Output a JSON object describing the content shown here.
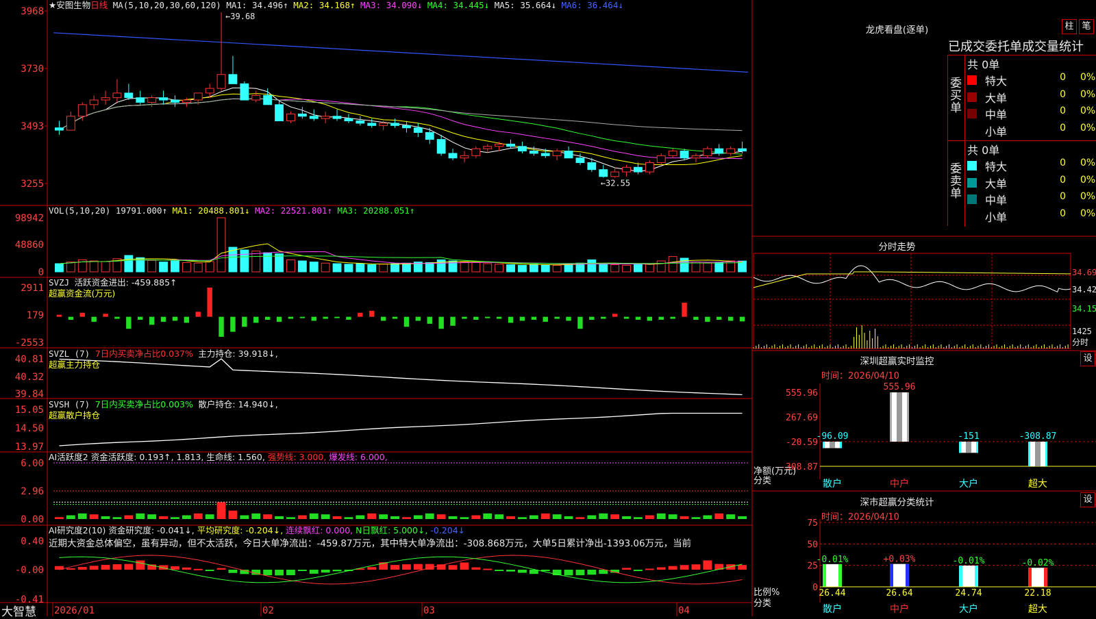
{
  "app": {
    "name": "大智慧"
  },
  "chart_data": [
    {
      "type": "candlestick",
      "name": "安图生物 日线",
      "interval": "日线",
      "x_labels": [
        "2026/01",
        "02",
        "03",
        "04"
      ],
      "y_ticks": [
        "3968",
        "3730",
        "3493",
        "3255"
      ],
      "high_mark": "39.68",
      "low_mark": "32.55",
      "ohlc": [
        [
          34.7,
          35.0,
          34.4,
          34.6
        ],
        [
          34.6,
          35.4,
          34.6,
          35.2
        ],
        [
          35.2,
          35.8,
          35.0,
          35.7
        ],
        [
          35.7,
          36.1,
          35.5,
          35.9
        ],
        [
          35.9,
          36.3,
          35.7,
          36.0
        ],
        [
          36.0,
          36.8,
          35.8,
          36.2
        ],
        [
          36.2,
          36.6,
          35.9,
          36.0
        ],
        [
          36.0,
          36.3,
          35.7,
          35.8
        ],
        [
          35.8,
          36.1,
          35.6,
          36.0
        ],
        [
          36.0,
          36.3,
          35.7,
          35.9
        ],
        [
          35.9,
          36.1,
          35.6,
          35.8
        ],
        [
          35.8,
          36.0,
          35.6,
          35.9
        ],
        [
          35.9,
          36.2,
          35.7,
          36.2
        ],
        [
          36.2,
          36.6,
          36.0,
          36.4
        ],
        [
          36.4,
          39.68,
          36.3,
          37.0
        ],
        [
          37.0,
          37.8,
          36.8,
          36.6
        ],
        [
          36.6,
          36.7,
          35.9,
          35.9
        ],
        [
          35.9,
          36.3,
          35.8,
          36.1
        ],
        [
          36.1,
          36.4,
          35.8,
          35.7
        ],
        [
          35.7,
          35.9,
          35.0,
          35.0
        ],
        [
          35.0,
          35.4,
          34.9,
          35.3
        ],
        [
          35.3,
          35.6,
          35.1,
          35.2
        ],
        [
          35.2,
          35.5,
          35.0,
          35.1
        ],
        [
          35.1,
          35.4,
          34.9,
          35.2
        ],
        [
          35.2,
          35.5,
          35.0,
          35.1
        ],
        [
          35.1,
          35.3,
          34.9,
          35.0
        ],
        [
          35.0,
          35.2,
          34.8,
          34.9
        ],
        [
          34.9,
          35.1,
          34.7,
          34.8
        ],
        [
          34.8,
          35.0,
          34.6,
          34.9
        ],
        [
          34.9,
          35.1,
          34.7,
          34.8
        ],
        [
          34.8,
          35.0,
          34.5,
          34.7
        ],
        [
          34.7,
          34.9,
          34.3,
          34.5
        ],
        [
          34.5,
          34.7,
          34.0,
          34.2
        ],
        [
          34.2,
          34.4,
          33.5,
          33.6
        ],
        [
          33.6,
          33.8,
          33.3,
          33.4
        ],
        [
          33.4,
          33.7,
          33.2,
          33.5
        ],
        [
          33.5,
          33.9,
          33.4,
          33.8
        ],
        [
          33.8,
          34.0,
          33.6,
          33.9
        ],
        [
          33.9,
          34.1,
          33.7,
          34.0
        ],
        [
          34.0,
          34.2,
          33.8,
          33.9
        ],
        [
          33.9,
          34.1,
          33.6,
          33.7
        ],
        [
          33.7,
          33.9,
          33.5,
          33.6
        ],
        [
          33.6,
          33.8,
          33.4,
          33.5
        ],
        [
          33.5,
          33.8,
          33.3,
          33.7
        ],
        [
          33.7,
          33.9,
          33.4,
          33.4
        ],
        [
          33.4,
          33.6,
          33.1,
          33.2
        ],
        [
          33.2,
          33.4,
          32.8,
          32.9
        ],
        [
          32.9,
          33.1,
          32.55,
          32.6
        ],
        [
          32.6,
          33.0,
          32.55,
          32.8
        ],
        [
          32.8,
          33.1,
          32.6,
          33.0
        ],
        [
          33.0,
          33.2,
          32.7,
          32.8
        ],
        [
          32.8,
          33.3,
          32.7,
          33.2
        ],
        [
          33.2,
          33.6,
          33.1,
          33.5
        ],
        [
          33.5,
          33.8,
          33.4,
          33.7
        ],
        [
          33.7,
          33.8,
          33.3,
          33.4
        ],
        [
          33.4,
          33.6,
          33.2,
          33.5
        ],
        [
          33.5,
          33.9,
          33.4,
          33.8
        ],
        [
          33.8,
          34.0,
          33.5,
          33.6
        ],
        [
          33.6,
          33.9,
          33.5,
          33.8
        ],
        [
          33.8,
          34.1,
          33.6,
          33.7
        ]
      ],
      "ma_values": {
        "MA1": "34.496",
        "MA2": "34.168",
        "MA3": "34.090",
        "MA4": "34.445",
        "MA5": "35.664",
        "MA6": "36.464"
      }
    },
    {
      "type": "bar",
      "name": "VOL(5,10,20)",
      "y_ticks": [
        "98942",
        "48860",
        "0"
      ],
      "values": [
        15000,
        18000,
        22000,
        20000,
        19000,
        24000,
        30000,
        26000,
        21000,
        18000,
        20000,
        17000,
        16000,
        19000,
        98942,
        45000,
        40000,
        38000,
        35000,
        33000,
        22000,
        20000,
        18000,
        16000,
        15000,
        14000,
        15000,
        13000,
        14000,
        15000,
        16000,
        18000,
        17000,
        22000,
        20000,
        18000,
        17000,
        15000,
        14000,
        13000,
        12000,
        14000,
        13000,
        12000,
        15000,
        16000,
        22000,
        14000,
        13000,
        12000,
        14000,
        15000,
        20000,
        28000,
        25000,
        18000,
        16000,
        17000,
        20000,
        19791
      ],
      "ma": {
        "MA1": "20488.801",
        "MA2": "22521.801",
        "MA3": "20288.051"
      }
    },
    {
      "type": "bar",
      "name": "SVZJ 活跃资金进出",
      "y_ticks": [
        "2911",
        "179",
        "-2553"
      ],
      "values": [
        200,
        -300,
        400,
        -500,
        300,
        -200,
        -1200,
        -300,
        -800,
        -500,
        -400,
        -600,
        500,
        2911,
        -2000,
        -1500,
        -1000,
        -600,
        -300,
        -500,
        -200,
        -100,
        -400,
        -200,
        -100,
        -300,
        400,
        600,
        -400,
        -200,
        -1000,
        -400,
        -700,
        -1200,
        -900,
        -200,
        -300,
        -100,
        -200,
        -600,
        -400,
        -300,
        -500,
        -200,
        -400,
        -1200,
        -300,
        -200,
        300,
        -200,
        -300,
        -400,
        -300,
        -200,
        1400,
        -300,
        -500,
        -300,
        -400,
        -460
      ],
      "value_label": "-459.885",
      "subtitle": "超赢资金流(万元)"
    },
    {
      "type": "line",
      "name": "SVZL 超赢主力持仓",
      "y_ticks": [
        "40.81",
        "40.32",
        "39.84"
      ],
      "value": "39.918",
      "ratio": "0.037%"
    },
    {
      "type": "line",
      "name": "SVSH 超赢散户持仓",
      "y_ticks": [
        "15.05",
        "14.50",
        "13.97"
      ],
      "value": "14.940",
      "ratio": "0.003%"
    },
    {
      "type": "bar",
      "name": "AI活跃度2 资金活跃度",
      "y_ticks": [
        "6.00",
        "2.96",
        "0.00"
      ],
      "values": {
        "资金活跃度": "0.193",
        "v2": "1.813",
        "生命线": "1.560",
        "强势线": "3.000",
        "爆发线": "6.000"
      }
    },
    {
      "type": "bar",
      "name": "AI研究度2(10) 资金研究度",
      "y_ticks": [
        "0.40",
        "-0.00",
        "-0.41"
      ],
      "values": {
        "资金研究度": "-0.041",
        "平均研究度": "-0.204",
        "连续飘红": "0.000",
        "N日飘红": "5.000",
        "last": "-0.204"
      },
      "note": "近期大资金总体偏空，虽有异动，但不太活跃，今日大单净流出：-459.87万元，其中特大单净流出：-308.868万元，大单5日累计净出-1393.06万元，当前"
    },
    {
      "type": "bar",
      "name": "深圳超赢实时监控",
      "date": "时间：2026/04/10",
      "categories": [
        "散户",
        "中户",
        "大户",
        "超大"
      ],
      "values": [
        -96.09,
        555.96,
        -151,
        -308.87
      ],
      "value_labels": [
        "-96.09",
        "555.96",
        "-151",
        "-308.87"
      ],
      "y_ticks": [
        "555.96",
        "267.69",
        "-20.59",
        "-308.87"
      ],
      "ylabel": "净额(万元)",
      "xlabel": "分类"
    },
    {
      "type": "bar",
      "name": "深市超赢分类统计",
      "date": "时间：2026/04/10",
      "categories": [
        "散户",
        "中户",
        "大户",
        "超大"
      ],
      "values": [
        26.44,
        26.64,
        24.74,
        22.18
      ],
      "changes": [
        "-0.01%",
        "+0.03%",
        "-0.01%",
        "-0.02%"
      ],
      "y_ticks": [
        "75",
        "50",
        "25",
        "0"
      ],
      "ylabel": "比例%",
      "xlabel": "分类"
    }
  ],
  "right": {
    "longhu": {
      "title": "龙虎看盘(逐单)",
      "btn1": "柱",
      "btn2": "笔",
      "subtitle": "已成交委托单成交量统计",
      "buy": {
        "label": "委买单",
        "total": "共 0单",
        "rows": [
          {
            "name": "特大",
            "count": "0",
            "pct": "0%",
            "color": "#ff0000"
          },
          {
            "name": "大单",
            "count": "0",
            "pct": "0%",
            "color": "#990000"
          },
          {
            "name": "中单",
            "count": "0",
            "pct": "0%",
            "color": "#770000"
          },
          {
            "name": "小单",
            "count": "0",
            "pct": "0%",
            "color": "#000000"
          }
        ]
      },
      "sell": {
        "label": "委卖单",
        "total": "共 0单",
        "rows": [
          {
            "name": "特大",
            "count": "0",
            "pct": "0%",
            "color": "#33ffff"
          },
          {
            "name": "大单",
            "count": "0",
            "pct": "0%",
            "color": "#009999"
          },
          {
            "name": "中单",
            "count": "0",
            "pct": "0%",
            "color": "#007777"
          },
          {
            "name": "小单",
            "count": "0",
            "pct": "0%",
            "color": "#000000"
          }
        ]
      }
    },
    "intraday": {
      "title": "分时走势",
      "y_labels": [
        "34.69",
        "34.42",
        "34.15",
        "1425"
      ],
      "vol_label": "分时"
    },
    "monitor": {
      "settings": "设"
    },
    "stats": {
      "settings": "设"
    }
  },
  "header": {
    "k": {
      "stock": "★安图生物",
      "period": "日线",
      "ma_def": "MA(5,10,20,30,60,120)",
      "ma1": "MA1: 34.496↑",
      "ma2": "MA2: 34.168↑",
      "ma3": "MA3: 34.090↓",
      "ma4": "MA4: 34.445↓",
      "ma5": "MA5: 35.664↓",
      "ma6": "MA6: 36.464↓"
    },
    "vol": {
      "name": "VOL(5,10,20)",
      "val": "19791.000↑",
      "ma1": "MA1: 20488.801↓",
      "ma2": "MA2: 22521.801↑",
      "ma3": "MA3: 20288.051↑"
    },
    "svzj": {
      "name": "SVZJ",
      "label": "活跃资金进出: -459.885↑",
      "sub": "超赢资金流(万元)"
    },
    "svzl": {
      "name": "SVZL (7)",
      "ratio": "7日内买卖净占比0.037%",
      "hold": "主力持仓: 39.918↓,",
      "sub": "超赢主力持仓"
    },
    "svsh": {
      "name": "SVSH (7)",
      "ratio": "7日内买卖净占比0.003%",
      "hold": "散户持仓: 14.940↓,",
      "sub": "超赢散户持仓"
    },
    "ai1": {
      "name": "AI活跃度2",
      "a": "资金活跃度: 0.193↑",
      "b": ", 1.813,",
      "c": "生命线: 1.560,",
      "d": "强势线: 3.000,",
      "e": "爆发线: 6.000,"
    },
    "ai2": {
      "name": "AI研究度2(10)",
      "a": "资金研究度: -0.041↓,",
      "b": "平均研究度: -0.204↓,",
      "c": "连续飘红: 0.000,",
      "d": "N日飘红: 5.000↓,",
      "e": "-0.204↓"
    }
  }
}
